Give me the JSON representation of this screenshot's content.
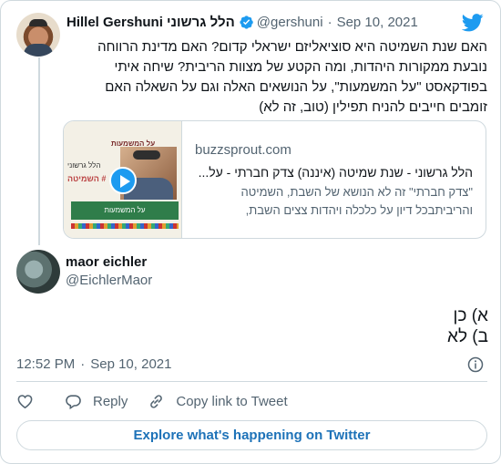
{
  "tweet": {
    "author_name": "Hillel Gershuni הלל גרשוני",
    "handle": "@gershuni",
    "separator": "·",
    "date": "Sep 10, 2021",
    "text": "האם שנת השמיטה היא סוציאליזם ישראלי קדום? האם מדינת הרווחה נובעת ממקורות היהדות, ומה הקטע של מצוות הריבית? שיחה איתי בפודקאסט \"על המשמעות\", על הנושאים האלה וגם על השאלה האם זומבים חייבים להניח תפילין (טוב, זה לא)"
  },
  "link_card": {
    "domain": "buzzsprout.com",
    "title": "הלל גרשוני - שנת שמיטה (איננה) צדק חברתי - על...",
    "description": "\"צדק חברתי\" זה לא הנושא של  השבת, השמיטה והריביתבכל דיון על כלכלה ויהדות צצים השבת,",
    "thumb_brand": "על המשמעות",
    "thumb_line1": "הלל גרשוני",
    "thumb_line2": "השמיטה #",
    "thumb_banner": "על המשמעות"
  },
  "reply": {
    "author_name": "maor eichler",
    "handle": "@EichlerMaor",
    "line1": "א) כן",
    "line2": "ב) לא",
    "time": "12:52 PM",
    "separator": "·",
    "date": "Sep 10, 2021"
  },
  "actions": {
    "reply_label": "Reply",
    "copy_label": "Copy link to Tweet"
  },
  "explore_label": "Explore what's happening on Twitter",
  "colors": {
    "accent": "#1d9bf0",
    "text": "#0f1419",
    "muted": "#536471",
    "border": "#cfd9de"
  }
}
